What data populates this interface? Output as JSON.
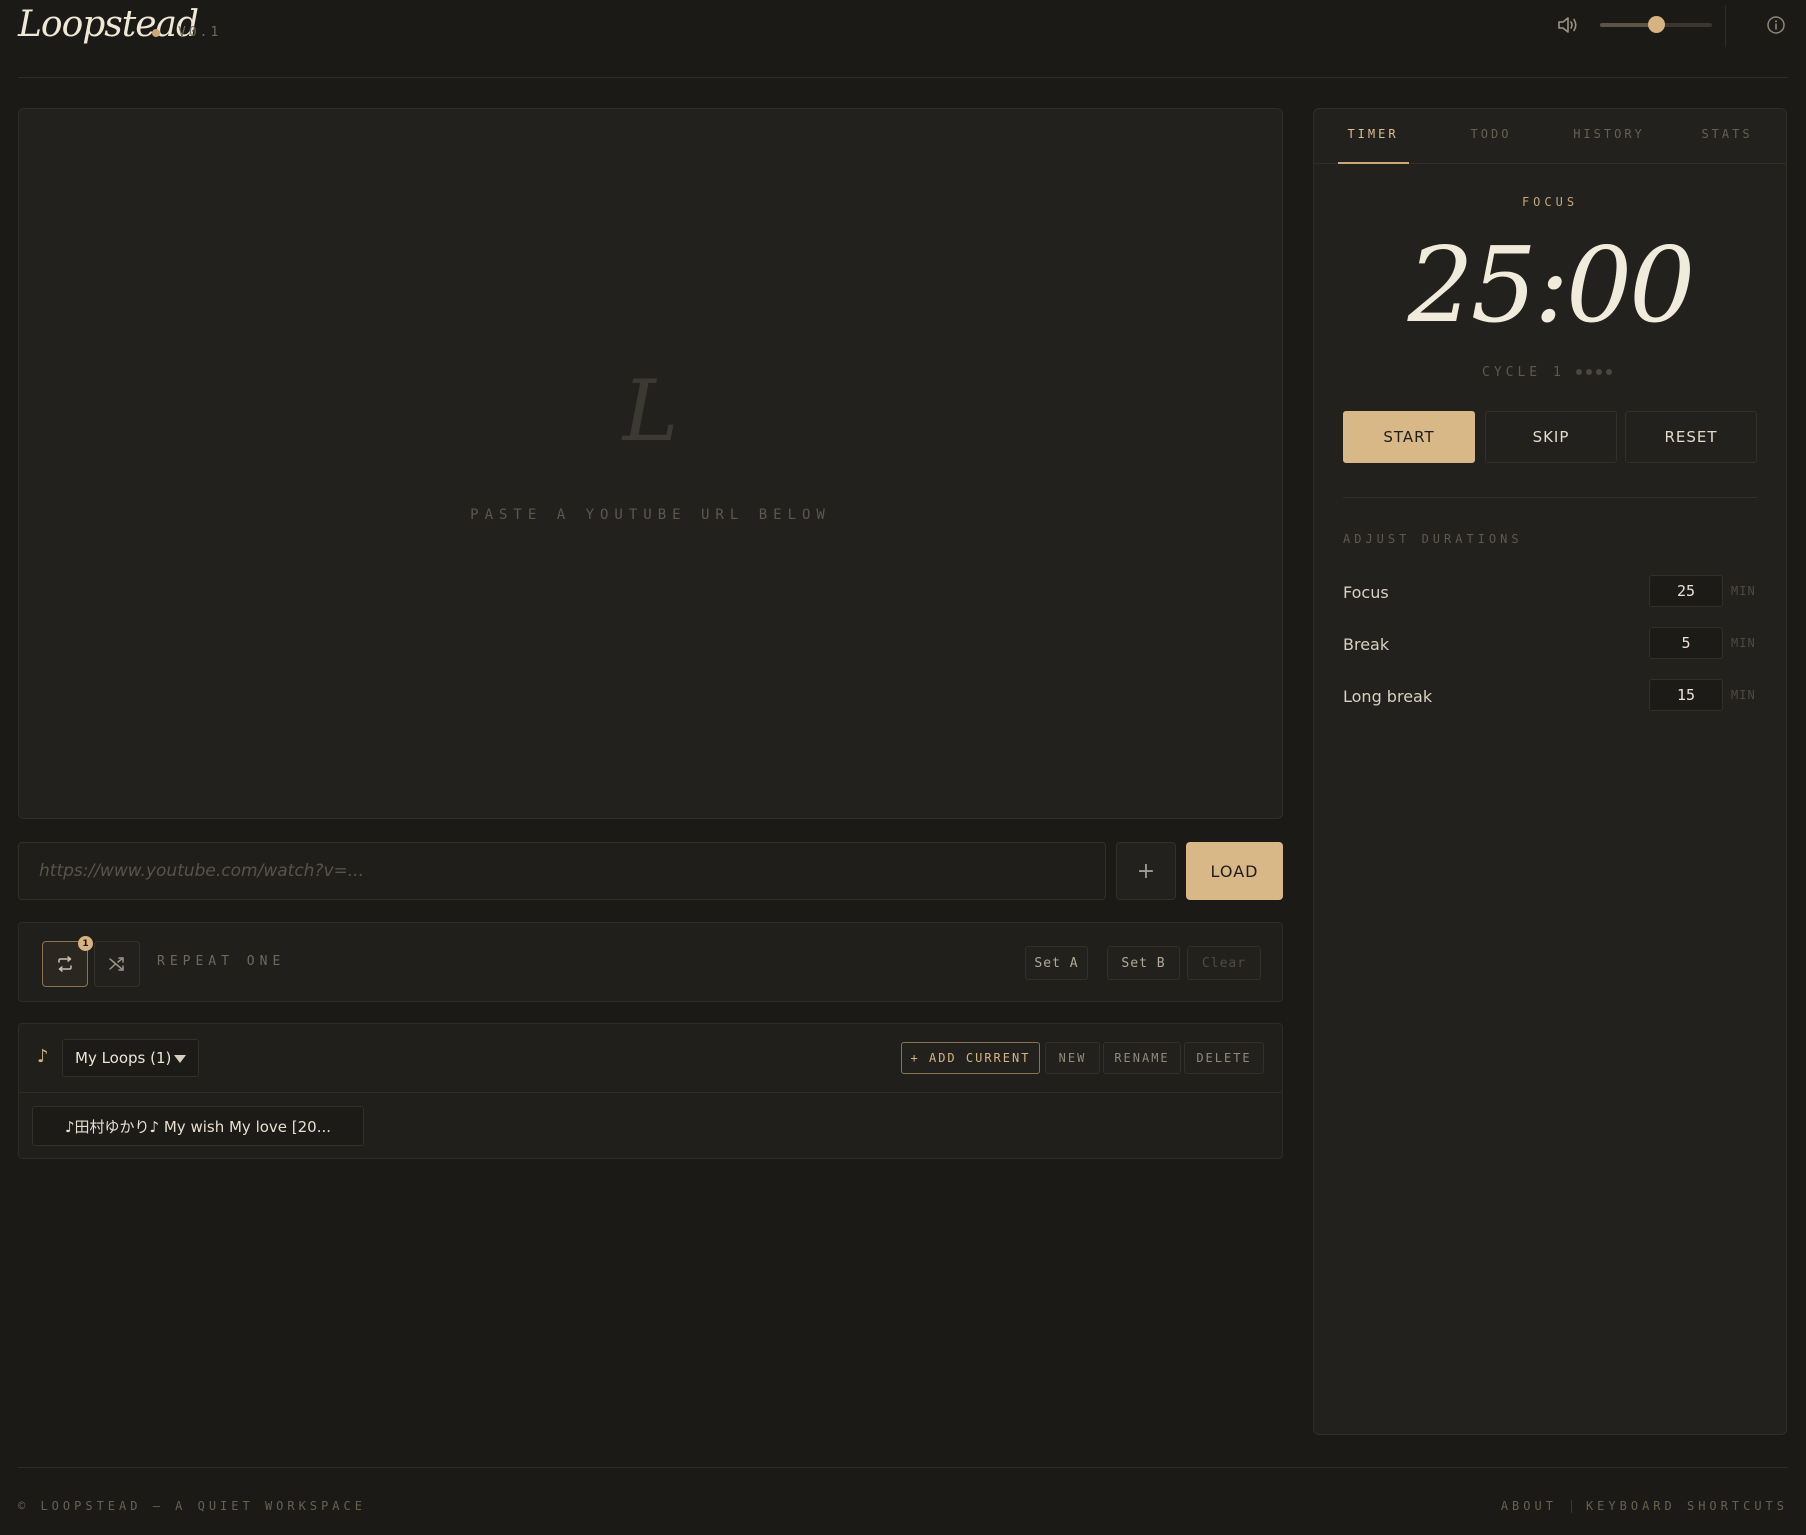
{
  "header": {
    "logo": "Loopstead",
    "version": "V0.1",
    "volume_level": 0.5,
    "volume_icon": "speaker-icon",
    "info_icon": "info-icon"
  },
  "player": {
    "placeholder_letter": "L",
    "hint": "PASTE A YOUTUBE URL BELOW"
  },
  "url_bar": {
    "placeholder": "https://www.youtube.com/watch?v=...",
    "value": "",
    "add_label": "+",
    "load_label": "LOAD"
  },
  "repeat": {
    "repeat_badge": "1",
    "mode_label": "REPEAT ONE",
    "set_a": "Set A",
    "set_b": "Set B",
    "clear": "Clear"
  },
  "loops": {
    "selected": "My Loops (1)",
    "add_current": "+ ADD CURRENT",
    "new": "NEW",
    "rename": "RENAME",
    "delete": "DELETE",
    "items": [
      {
        "title": "♪田村ゆかり♪ My wish My love [20..."
      }
    ]
  },
  "sidebar": {
    "tabs": [
      "TIMER",
      "TODO",
      "HISTORY",
      "STATS"
    ],
    "active_tab": "TIMER",
    "timer": {
      "mode": "FOCUS",
      "time": "25:00",
      "cycle": "CYCLE 1",
      "cycle_dots_total": 4,
      "start": "START",
      "skip": "SKIP",
      "reset": "RESET"
    },
    "durations": {
      "title": "ADJUST DURATIONS",
      "unit": "MIN",
      "rows": [
        {
          "label": "Focus",
          "value": "25"
        },
        {
          "label": "Break",
          "value": "5"
        },
        {
          "label": "Long break",
          "value": "15"
        }
      ]
    }
  },
  "footer": {
    "copyright": "© LOOPSTEAD — A QUIET WORKSPACE",
    "about": "ABOUT",
    "shortcuts": "KEYBOARD SHORTCUTS"
  },
  "colors": {
    "background": "#1b1a17",
    "accent": "#d8b887",
    "text": "#e8e2d3"
  }
}
